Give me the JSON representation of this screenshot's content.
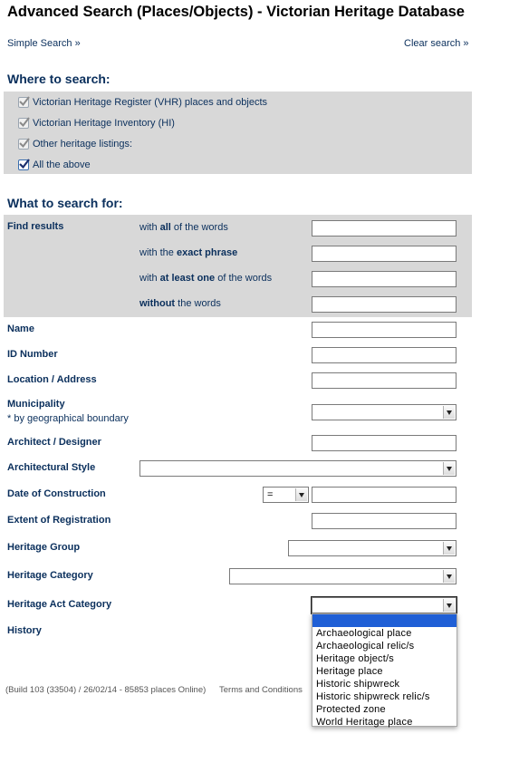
{
  "header": {
    "title": "Advanced Search (Places/Objects) - Victorian Heritage Database",
    "simple_search": "Simple Search »",
    "clear_search": "Clear search »"
  },
  "where": {
    "heading": "Where to search:",
    "options": [
      {
        "label": "Victorian Heritage Register (VHR) places and objects",
        "checked": true,
        "disabled": true
      },
      {
        "label": "Victorian Heritage Inventory (HI)",
        "checked": true,
        "disabled": true
      },
      {
        "label": "Other heritage listings:",
        "checked": true,
        "disabled": true
      },
      {
        "label": "All the above",
        "checked": true,
        "disabled": false
      }
    ]
  },
  "what": {
    "heading": "What to search for:",
    "find_results": "Find results",
    "all_words": {
      "pre": "with ",
      "bold": "all",
      "post": " of the words",
      "value": ""
    },
    "exact_phrase": {
      "pre": "with the ",
      "bold": "exact phrase",
      "post": "",
      "value": ""
    },
    "at_least_one": {
      "pre": "with ",
      "bold": "at least one",
      "post": " of the words",
      "value": ""
    },
    "without": {
      "pre": "",
      "bold": "without",
      "post": " the words",
      "value": ""
    }
  },
  "fields": {
    "name": {
      "label": "Name",
      "value": ""
    },
    "id_number": {
      "label": "ID Number",
      "value": ""
    },
    "location": {
      "label": "Location / Address",
      "value": ""
    },
    "municipality": {
      "label": "Municipality",
      "note": "* by geographical boundary",
      "selected": ""
    },
    "architect": {
      "label": "Architect / Designer",
      "value": ""
    },
    "arch_style": {
      "label": "Architectural Style",
      "selected": ""
    },
    "date_construction": {
      "label": "Date of Construction",
      "operator": "=",
      "value": ""
    },
    "extent": {
      "label": "Extent of Registration",
      "value": ""
    },
    "heritage_group": {
      "label": "Heritage Group",
      "selected": ""
    },
    "heritage_category": {
      "label": "Heritage Category",
      "selected": ""
    },
    "heritage_act_category": {
      "label": "Heritage Act Category",
      "selected": "",
      "options": [
        "",
        "Archaeological place",
        "Archaeological relic/s",
        "Heritage object/s",
        "Heritage place",
        "Historic shipwreck",
        "Historic shipwreck relic/s",
        "Protected zone",
        "World Heritage place"
      ]
    },
    "history": {
      "label": "History"
    }
  },
  "footer": {
    "build": "(Build 103 (33504) / 26/02/14 - 85853 places Online)",
    "terms": "Terms and Conditions"
  },
  "colors": {
    "text": "#0a2f5c",
    "panel": "#d8d8d8",
    "highlight": "#1f5fd6"
  }
}
